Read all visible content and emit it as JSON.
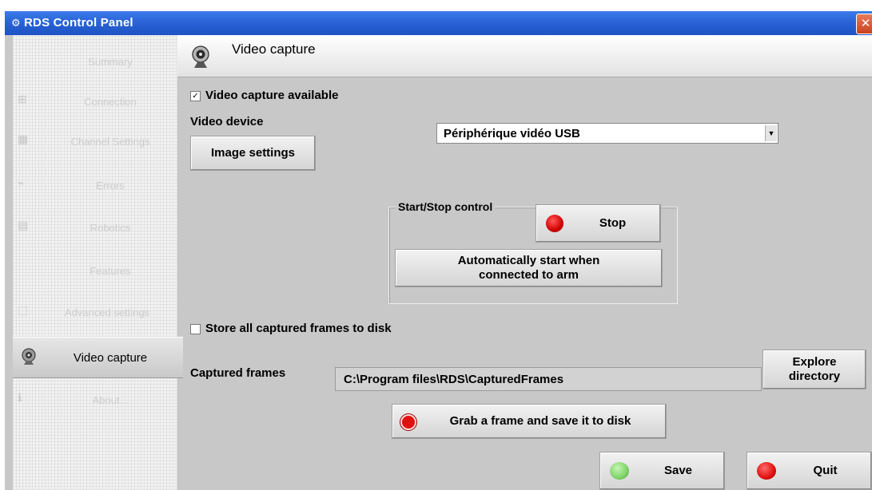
{
  "window": {
    "title": "RDS Control Panel",
    "title_icon": "app-icon",
    "close_label": "✕"
  },
  "sidebar": {
    "items": [
      {
        "label": "Summary",
        "icon": "summary-icon",
        "active": false
      },
      {
        "label": "Connection",
        "icon": "connection-icon",
        "active": false
      },
      {
        "label": "Channel Settings",
        "icon": "channel-icon",
        "active": false
      },
      {
        "label": "Errors",
        "icon": "errors-icon",
        "active": false
      },
      {
        "label": "Robotics",
        "icon": "robotics-icon",
        "active": false
      },
      {
        "label": "Features",
        "icon": "features-icon",
        "active": false
      },
      {
        "label": "Advanced settings",
        "icon": "advanced-icon",
        "active": false
      },
      {
        "label": "Video capture",
        "icon": "webcam-icon",
        "active": true
      },
      {
        "label": "About...",
        "icon": "about-icon",
        "active": false
      }
    ]
  },
  "header": {
    "title": "Video capture",
    "icon": "webcam-icon"
  },
  "video_capture": {
    "available_label": "Video capture available",
    "available_checked": true,
    "device_label": "Video device",
    "device_value": "Périphérique vidéo USB",
    "image_settings_label": "Image settings",
    "start_stop": {
      "group_title": "Start/Stop control",
      "stop_label": "Stop",
      "auto_start_label": "Automatically start when connected to arm"
    },
    "store_frames_label": "Store all captured frames to disk",
    "store_frames_checked": false,
    "captured_frames_label": "Captured frames",
    "captured_frames_path": "C:\\Program files\\RDS\\CapturedFrames",
    "explore_label": "Explore directory",
    "grab_label": "Grab a frame and save it to disk"
  },
  "footer": {
    "save_label": "Save",
    "quit_label": "Quit"
  },
  "colors": {
    "titlebar": "#2a64d8",
    "panel_bg": "#c8c8c8",
    "stop_red": "#e01010",
    "save_green": "#7ed46a"
  }
}
